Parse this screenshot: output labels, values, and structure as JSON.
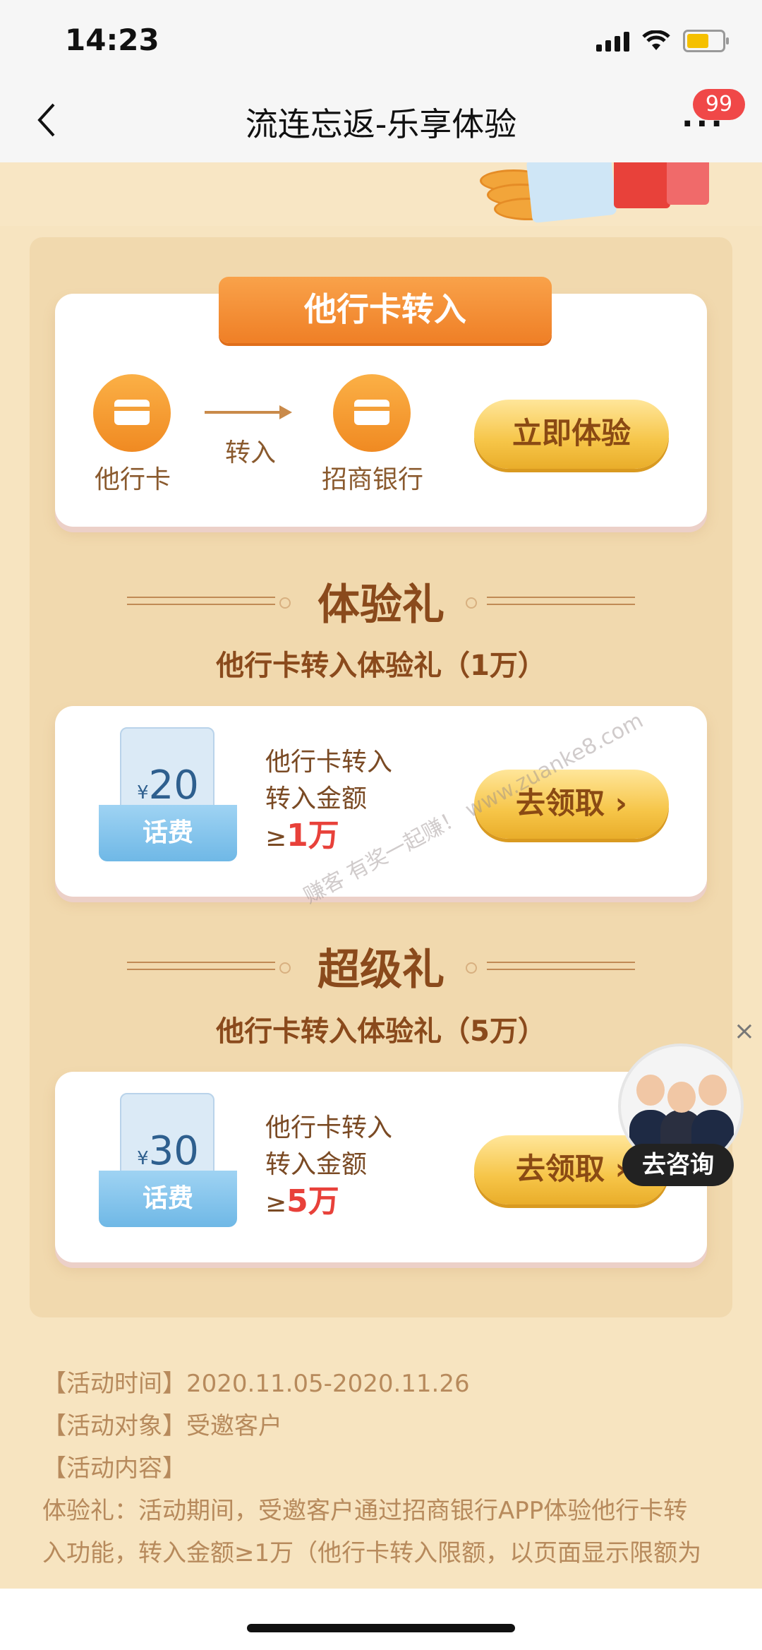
{
  "status_bar": {
    "time": "14:23"
  },
  "nav": {
    "title": "流连忘返-乐享体验",
    "more": "···",
    "badge": "99"
  },
  "transfer": {
    "tab_title": "他行卡转入",
    "from_label": "他行卡",
    "arrow_label": "转入",
    "to_label": "招商银行",
    "cta": "立即体验"
  },
  "gift1": {
    "heading": "体验礼",
    "subtitle": "他行卡转入体验礼（1万）",
    "currency": "¥",
    "amount": "20",
    "voucher_label": "话费",
    "line1": "他行卡转入",
    "line2": "转入金额",
    "prefix": "≥",
    "min": "1万",
    "cta": "去领取"
  },
  "gift2": {
    "heading": "超级礼",
    "subtitle": "他行卡转入体验礼（5万）",
    "currency": "¥",
    "amount": "30",
    "voucher_label": "话费",
    "line1": "他行卡转入",
    "line2": "转入金额",
    "prefix": "≥",
    "min": "5万",
    "cta": "去领取"
  },
  "consult": {
    "close": "×",
    "label": "去咨询"
  },
  "watermark": "赚客 有奖一起赚！ www.zuanke8.com",
  "rules": {
    "time": "【活动时间】2020.11.05-2020.11.26",
    "target": "【活动对象】受邀客户",
    "content_title": "【活动内容】",
    "content_1": "体验礼：活动期间，受邀客户通过招商银行APP体验他行卡转",
    "content_2": "入功能，转入金额≥1万（他行卡转入限额，以页面显示限额为"
  }
}
